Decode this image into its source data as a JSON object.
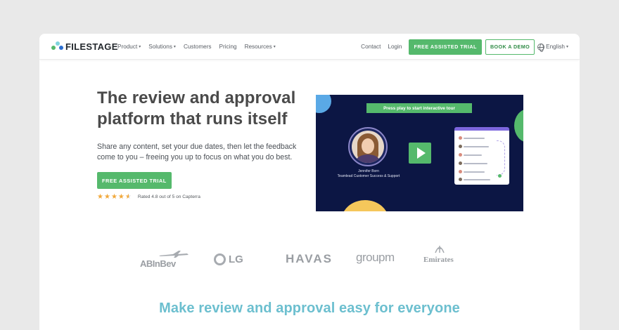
{
  "nav": {
    "logo_text": "FILESTAGE",
    "menu": [
      {
        "label": "Product",
        "has_caret": true
      },
      {
        "label": "Solutions",
        "has_caret": true
      },
      {
        "label": "Customers",
        "has_caret": false
      },
      {
        "label": "Pricing",
        "has_caret": false
      },
      {
        "label": "Resources",
        "has_caret": true
      }
    ],
    "contact": "Contact",
    "login": "Login",
    "trial_button": "FREE ASSISTED TRIAL",
    "demo_button": "BOOK A DEMO",
    "language": "English",
    "caret_glyph": "▾"
  },
  "hero": {
    "headline": "The review and approval platform that runs itself",
    "subtext": "Share any content, set your due dates, then let the feedback come to you – freeing you up to focus on what you do best.",
    "cta": "FREE ASSISTED TRIAL",
    "rating_stars": 4.5,
    "rating_text": "Rated 4.8 out of 5 on Capterra"
  },
  "video": {
    "banner": "Press play to start interactive tour",
    "person_name": "Jennifer Born",
    "person_title": "Teamlead Customer Success & Support"
  },
  "logos": [
    "ABInBev",
    "LG",
    "HAVAS",
    "groupm",
    "Emirates"
  ],
  "section": {
    "title": "Make review and approval easy for everyone"
  },
  "colors": {
    "accent_green": "#55b96c",
    "video_bg": "#0c1644",
    "title_teal": "#6cbfcf",
    "star": "#f1a83b"
  }
}
